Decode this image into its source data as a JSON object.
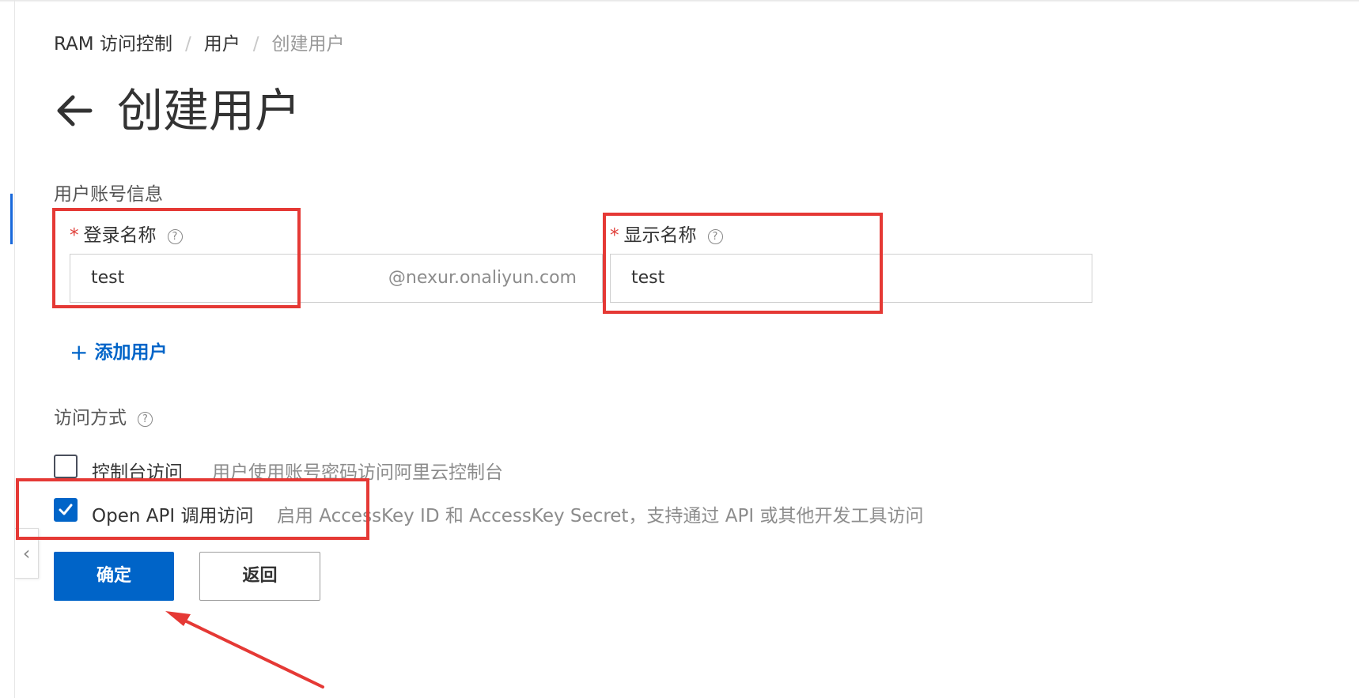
{
  "breadcrumb": {
    "items": [
      "RAM 访问控制",
      "用户"
    ],
    "current": "创建用户",
    "separator": "/"
  },
  "page": {
    "title": "创建用户"
  },
  "account_section": {
    "label": "用户账号信息"
  },
  "login_name": {
    "label": "登录名称",
    "required_mark": "*",
    "value": "test",
    "suffix": "@nexur.onaliyun.com"
  },
  "display_name": {
    "label": "显示名称",
    "required_mark": "*",
    "value": "test"
  },
  "add_user": {
    "label": "添加用户"
  },
  "access_section": {
    "label": "访问方式"
  },
  "access_options": [
    {
      "label": "控制台访问",
      "description": "用户使用账号密码访问阿里云控制台",
      "checked": false
    },
    {
      "label": "Open API 调用访问",
      "description": "启用 AccessKey ID 和 AccessKey Secret，支持通过 API 或其他开发工具访问",
      "checked": true
    }
  ],
  "buttons": {
    "confirm": "确定",
    "back": "返回"
  },
  "colors": {
    "primary": "#0064c8",
    "required": "#e0413b",
    "annotation": "#e53935"
  },
  "icons": {
    "back": "arrow-left-icon",
    "help": "question-circle-icon",
    "add": "plus-icon",
    "collapse": "chevron-left-icon"
  }
}
